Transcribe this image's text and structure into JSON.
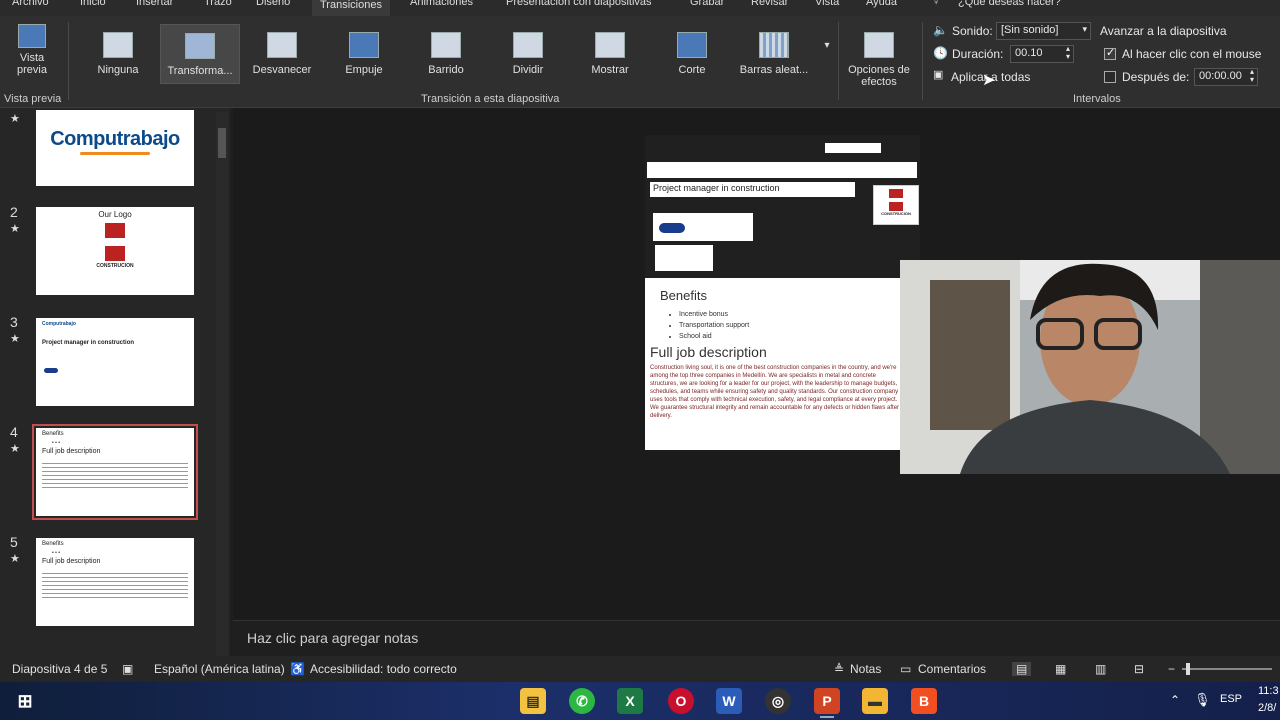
{
  "menu": {
    "tabs": [
      "Archivo",
      "Inicio",
      "Insertar",
      "Trazo",
      "Diseño",
      "Transiciones",
      "Animaciones",
      "Presentación con diapositivas",
      "Grabar",
      "Revisar",
      "Vista",
      "Ayuda"
    ],
    "active": "Transiciones",
    "search": "¿Qué deseas hacer?"
  },
  "ribbon": {
    "preview_label": "Vista previa",
    "preview_group": "Vista previa",
    "transitions": [
      "Ninguna",
      "Transforma...",
      "Desvanecer",
      "Empuje",
      "Barrido",
      "Dividir",
      "Mostrar",
      "Corte",
      "Barras aleat..."
    ],
    "selected_transition": "Transforma...",
    "transition_group": "Transición a esta diapositiva",
    "effect_options": "Opciones de efectos",
    "sound_label": "Sonido:",
    "sound_value": "[Sin sonido]",
    "duration_label": "Duración:",
    "duration_value": "00.10",
    "apply_all": "Aplicar a todas",
    "advance_title": "Avanzar a la diapositiva",
    "on_click": "Al hacer clic con el mouse",
    "on_click_checked": true,
    "after_label": "Después de:",
    "after_value": "00:00.00",
    "after_checked": false,
    "timing_group": "Intervalos"
  },
  "slides": [
    {
      "num": "",
      "mark": "★",
      "title": "Computrabajo"
    },
    {
      "num": "2",
      "mark": "★",
      "title": "Our Logo",
      "caption": "CONSTRUCION"
    },
    {
      "num": "3",
      "mark": "★",
      "title": "Project manager in construction"
    },
    {
      "num": "4",
      "mark": "★",
      "title": "Benefits",
      "sub": "Full job description"
    },
    {
      "num": "5",
      "mark": "★",
      "title": "Benefits",
      "sub": "Full job description"
    }
  ],
  "canvas": {
    "job_title": "Project manager in construction",
    "logo_caption": "CONSTRUCION",
    "benefits_title": "Benefits",
    "benefits": [
      "Incentive bonus",
      "Transportation support",
      "School aid"
    ],
    "full_title": "Full job description",
    "description": "Construction living soul, it is one of the best construction companies in the country, and we're among the top three companies in Medellín. We are specialists in metal and concrete structures, we are looking for a leader for our project, with the leadership to manage budgets, schedules, and teams while ensuring safety and quality standards. Our construction company uses tools that comply with technical execution, safety, and legal compliance at every project. We guarantee structural integrity and remain accountable for any defects or hidden flaws after delivery."
  },
  "notes_placeholder": "Haz clic para agregar notas",
  "status": {
    "slide": "Diapositiva 4 de 5",
    "lang": "Español (América latina)",
    "access": "Accesibilidad: todo correcto",
    "notes": "Notas",
    "comments": "Comentarios"
  },
  "taskbar": {
    "lang": "ESP",
    "time": "11:3",
    "date": "2/8/"
  }
}
